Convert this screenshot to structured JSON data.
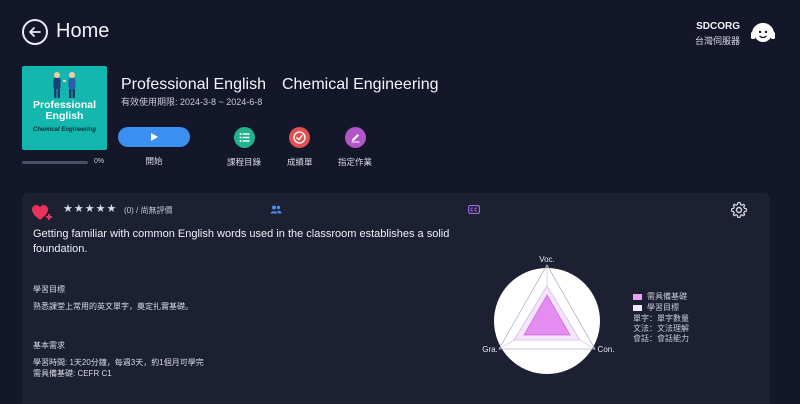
{
  "header": {
    "title": "Home",
    "support_name": "SDCORG",
    "support_sub": "台灣伺服器"
  },
  "course": {
    "cover_title": "Professional English",
    "cover_subtitle": "Chemical Engineering",
    "title": "Professional English　Chemical Engineering",
    "validity": "有效使用期限: 2024-3-8 ~ 2024-6-8",
    "progress": 0,
    "progress_label": "0%"
  },
  "actions": {
    "start": "開始",
    "catalog": "課程目錄",
    "grades": "成績單",
    "assignment": "指定作業"
  },
  "colors": {
    "start_button": "#3a8ff0",
    "catalog": "#22b38e",
    "grades": "#e0524f",
    "assignment": "#b156c8",
    "heart": "#e8325c",
    "radar_fill": "#e58cf0"
  },
  "card": {
    "rating_text": "(0) /  尚無評價",
    "stars": 5,
    "description": "Getting familiar with common English words used in the classroom establishes a solid foundation.",
    "goal_title": "學習目標",
    "goal_text": "熟悉課堂上常用的英文單字，奠定扎實基礎。",
    "req_title": "基本需求",
    "req_line1": "學習時間: 1天20分鐘，每週3天，約1個月可學完",
    "req_line2": "需具備基礎: CEFR C1"
  },
  "radar": {
    "axis_top": "Voc.",
    "axis_left": "Gra.",
    "axis_right": "Con.",
    "legend": [
      {
        "label": "需具備基礎",
        "color": "#e9a0f2"
      },
      {
        "label": "學習目標",
        "color": "#f3e6fb"
      }
    ],
    "notes": [
      "單字：單字數量",
      "文法：文法理解",
      "會話：會話能力"
    ]
  }
}
